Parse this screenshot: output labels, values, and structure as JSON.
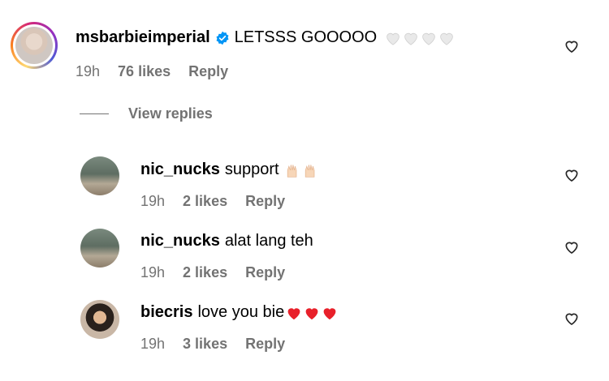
{
  "comments": [
    {
      "username": "msbarbieimperial",
      "verified": true,
      "text": "LETSSS GOOOOO",
      "emoji": "white-heart x4",
      "time": "19h",
      "likes": "76 likes",
      "reply_label": "Reply"
    },
    {
      "username": "nic_nucks",
      "text": "support",
      "emoji": "raising-hands x2",
      "time": "19h",
      "likes": "2 likes",
      "reply_label": "Reply"
    },
    {
      "username": "nic_nucks",
      "text": "alat lang teh",
      "time": "19h",
      "likes": "2 likes",
      "reply_label": "Reply"
    },
    {
      "username": "biecris",
      "text": "love you bie",
      "emoji": "red-heart x3",
      "time": "19h",
      "likes": "3 likes",
      "reply_label": "Reply"
    }
  ],
  "view_replies_label": "View replies",
  "colors": {
    "muted": "#737373",
    "verified": "#0095f6",
    "red_heart": "#e8202a",
    "white_heart": "#e9e9e9"
  }
}
